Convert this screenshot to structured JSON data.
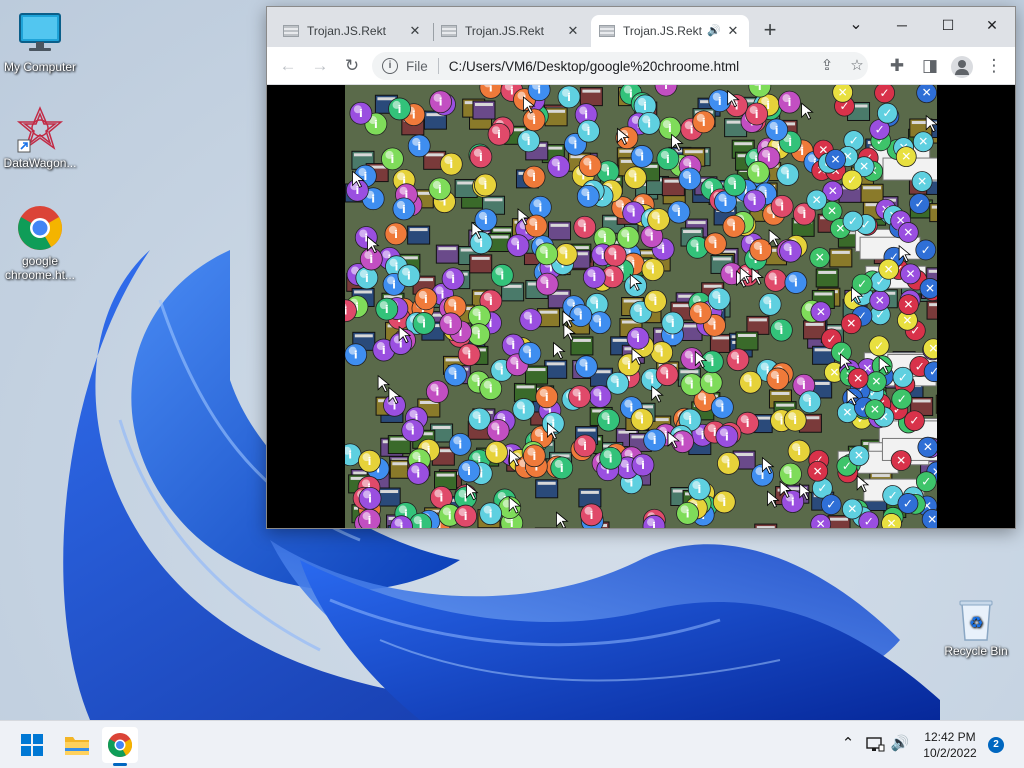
{
  "desktop": {
    "icons": [
      {
        "label": "My Computer",
        "icon": "monitor-icon"
      },
      {
        "label": "DataWagon...",
        "icon": "datawagon-icon"
      },
      {
        "label": "google chroome.ht...",
        "icon": "chrome-icon"
      }
    ],
    "recycle_bin": {
      "label": "Recycle Bin",
      "icon": "recycle-bin-icon"
    }
  },
  "browser": {
    "tabs": [
      {
        "title": "Trojan.JS.Rekt",
        "active": false
      },
      {
        "title": "Trojan.JS.Rekt",
        "active": false
      },
      {
        "title": "Trojan.JS.Rekt",
        "active": true,
        "audio": true
      }
    ],
    "new_tab_glyph": "+",
    "window_controls": {
      "chevron": "⌄",
      "minimize": "─",
      "maximize": "☐",
      "close": "✕"
    },
    "toolbar": {
      "back": "←",
      "forward": "→",
      "reload": "↻",
      "info": "i",
      "scheme": "File",
      "url": "C:/Users/VM6/Desktop/google%20chroome.html"
    },
    "content": "glitch-icon-flood"
  },
  "taskbar": {
    "apps": [
      "windows-start-icon",
      "file-explorer-icon",
      "chrome-icon"
    ],
    "tray": [
      "chevron-up-icon",
      "network-icon",
      "volume-icon"
    ],
    "time": "12:42 PM",
    "date": "10/2/2022",
    "notification_count": "2"
  },
  "colors": {
    "accent": "#0067c0",
    "tabstrip": "#dee1e6",
    "wallpaper_blue": "#1f5fd6"
  }
}
